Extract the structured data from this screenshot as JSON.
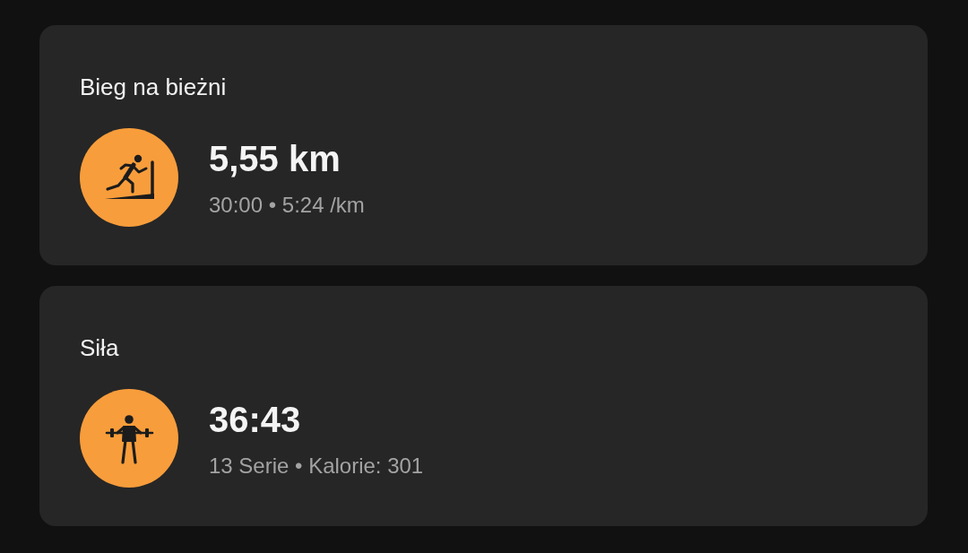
{
  "activities": [
    {
      "kind": "treadmill",
      "title": "Bieg na bieżni",
      "value": "5,55 km",
      "details": "30:00 • 5:24 /km"
    },
    {
      "kind": "strength",
      "title": "Siła",
      "value": "36:43",
      "details": "13 Serie • Kalorie: 301"
    }
  ]
}
